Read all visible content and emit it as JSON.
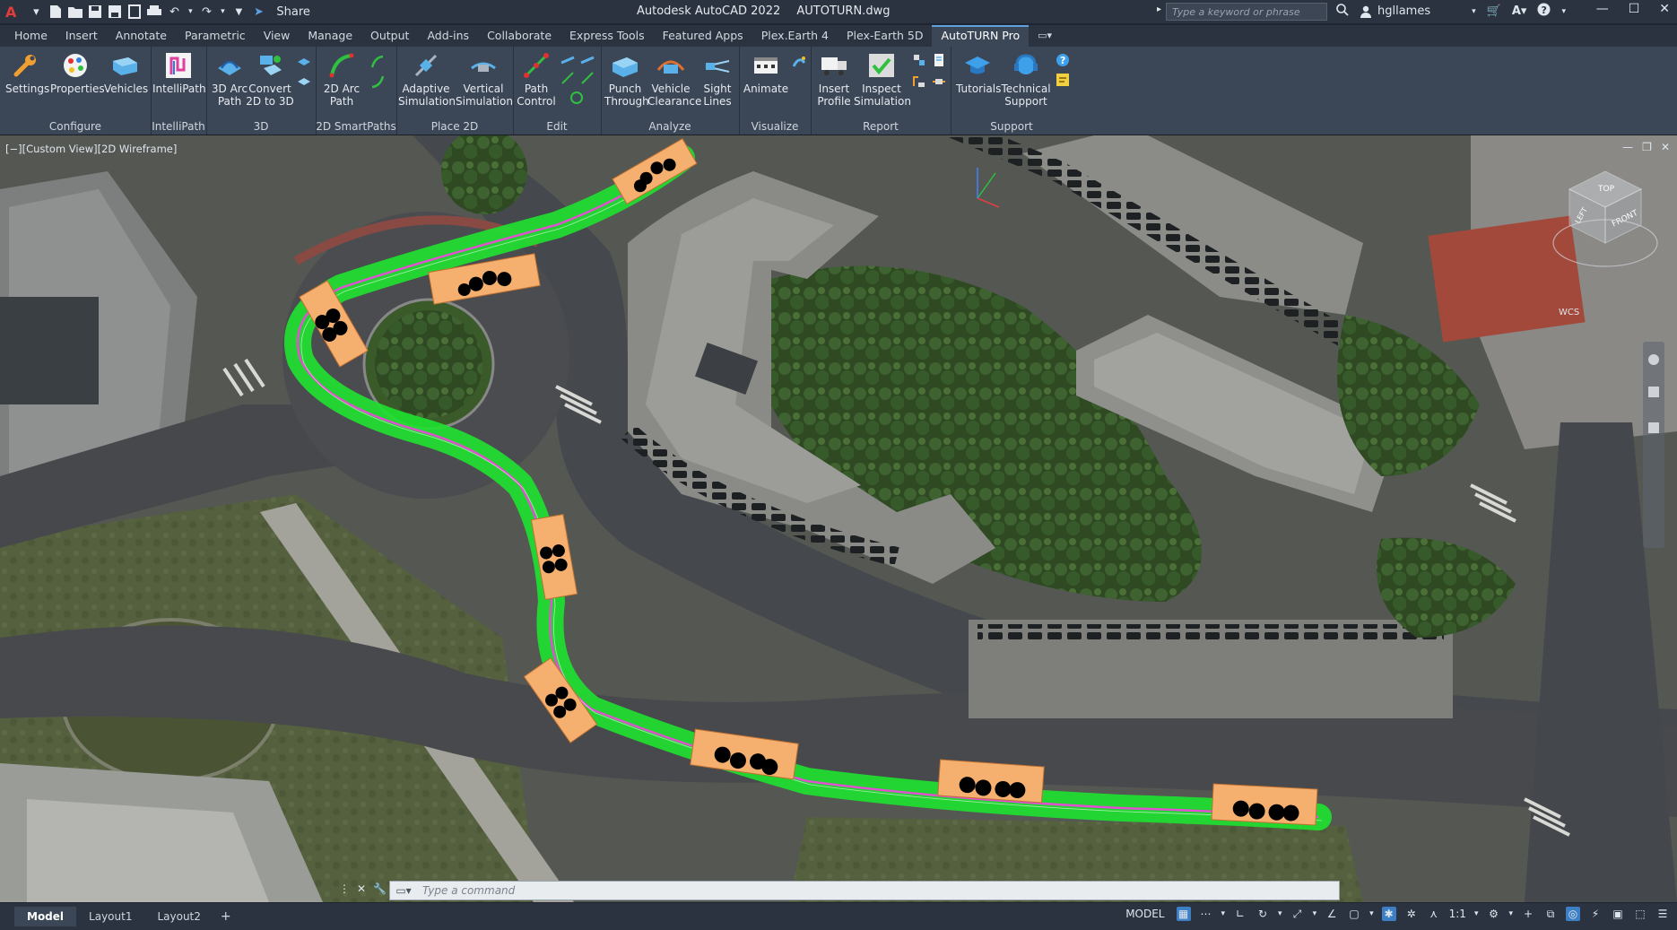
{
  "app": {
    "logo": "A",
    "share_label": "Share",
    "title": "Autodesk AutoCAD 2022",
    "filename": "AUTOTURN.dwg",
    "search_placeholder": "Type a keyword or phrase",
    "username": "hgllames"
  },
  "tabs": [
    {
      "label": "Home"
    },
    {
      "label": "Insert"
    },
    {
      "label": "Annotate"
    },
    {
      "label": "Parametric"
    },
    {
      "label": "View"
    },
    {
      "label": "Manage"
    },
    {
      "label": "Output"
    },
    {
      "label": "Add-ins"
    },
    {
      "label": "Collaborate"
    },
    {
      "label": "Express Tools"
    },
    {
      "label": "Featured Apps"
    },
    {
      "label": "Plex.Earth 4"
    },
    {
      "label": "Plex-Earth 5D"
    },
    {
      "label": "AutoTURN Pro",
      "active": true
    }
  ],
  "ribbon": {
    "configure": {
      "label": "Configure",
      "settings": "Settings",
      "properties": "Properties",
      "vehicles": "Vehicles"
    },
    "intellipath": {
      "label": "IntelliPath",
      "btn": "IntelliPath"
    },
    "p3d": {
      "label": "3D",
      "arc1": "3D Arc",
      "arc2": "Path",
      "conv1": "Convert",
      "conv2": "2D to 3D"
    },
    "smart": {
      "label": "2D SmartPaths",
      "arc1": "2D Arc",
      "arc2": "Path"
    },
    "place": {
      "label": "Place 2D",
      "adapt1": "Adaptive",
      "adapt2": "Simulation",
      "vert1": "Vertical",
      "vert2": "Simulation"
    },
    "edit": {
      "label": "Edit",
      "pc1": "Path",
      "pc2": "Control"
    },
    "analyze": {
      "label": "Analyze",
      "pt1": "Punch",
      "pt2": "Through",
      "vc1": "Vehicle",
      "vc2": "Clearance",
      "sl1": "Sight",
      "sl2": "Lines"
    },
    "visualize": {
      "label": "Visualize",
      "animate": "Animate"
    },
    "report": {
      "label": "Report",
      "ip1": "Insert",
      "ip2": "Profile",
      "is1": "Inspect",
      "is2": "Simulation"
    },
    "support": {
      "label": "Support",
      "tut": "Tutorials",
      "ts1": "Technical",
      "ts2": "Support"
    }
  },
  "viewport": {
    "label": "[−][Custom View][2D Wireframe]",
    "wcs": "WCS",
    "cube_top": "TOP",
    "cube_front": "FRONT",
    "cube_left": "LEFT"
  },
  "command": {
    "placeholder": "Type a command"
  },
  "layouts": [
    {
      "label": "Model",
      "active": true
    },
    {
      "label": "Layout1"
    },
    {
      "label": "Layout2"
    }
  ],
  "status": {
    "model": "MODEL",
    "scale": "1:1"
  }
}
